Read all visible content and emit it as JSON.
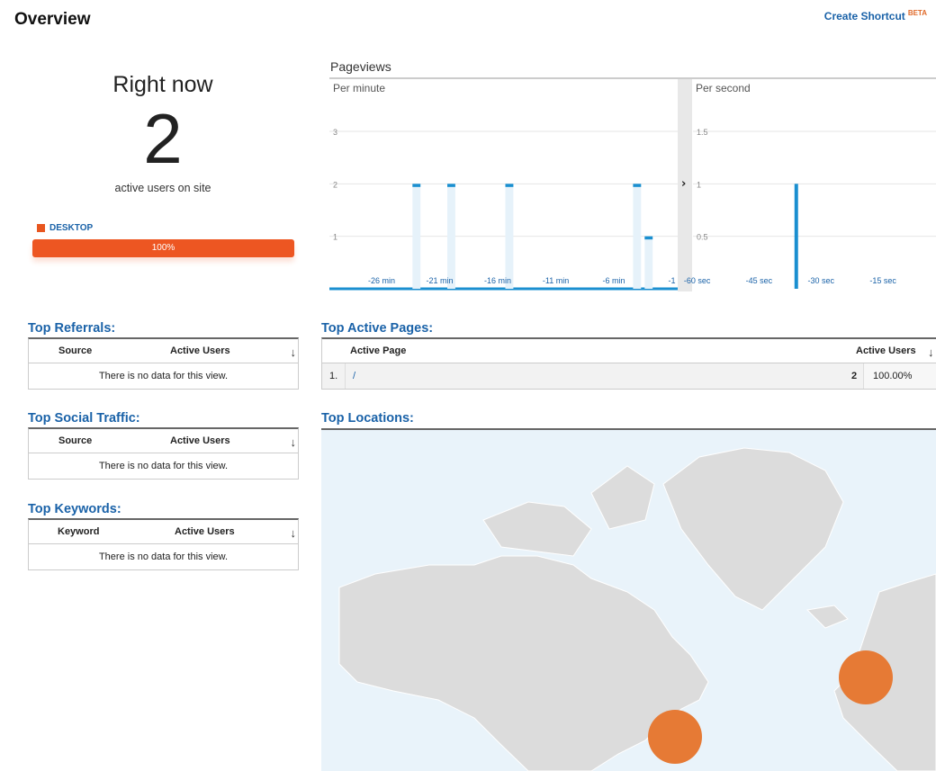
{
  "header": {
    "title": "Overview",
    "shortcut_label": "Create Shortcut",
    "shortcut_badge": "BETA"
  },
  "right_now": {
    "title": "Right now",
    "count": "2",
    "subtitle": "active users on site",
    "device_label": "DESKTOP",
    "device_percent": "100%",
    "device_fraction": 1.0,
    "device_color": "#ed5622"
  },
  "pageviews": {
    "title": "Pageviews",
    "per_minute_label": "Per minute",
    "per_second_label": "Per second",
    "expand_glyph": "›"
  },
  "chart_data": [
    {
      "type": "bar",
      "title": "Per minute",
      "x": [
        -30,
        -29,
        -28,
        -27,
        -26,
        -25,
        -24,
        -23,
        -22,
        -21,
        -20,
        -19,
        -18,
        -17,
        -16,
        -15,
        -14,
        -13,
        -12,
        -11,
        -10,
        -9,
        -8,
        -7,
        -6,
        -5,
        -4,
        -3,
        -2,
        -1
      ],
      "values": [
        0,
        0,
        0,
        0,
        0,
        0,
        0,
        2,
        0,
        0,
        2,
        0,
        0,
        0,
        0,
        2,
        0,
        0,
        0,
        0,
        0,
        0,
        0,
        0,
        0,
        0,
        2,
        1,
        0,
        0
      ],
      "tick_labels": [
        "-26 min",
        "-21 min",
        "-16 min",
        "-11 min",
        "-6 min",
        "-1"
      ],
      "tick_values": [
        -26,
        -21,
        -16,
        -11,
        -6,
        -1
      ],
      "ytick_labels": [
        "1",
        "2",
        "3"
      ],
      "ylim": [
        0,
        3
      ],
      "color": "#1a8fd0"
    },
    {
      "type": "bar",
      "title": "Per second",
      "x": [
        -36
      ],
      "values": [
        1
      ],
      "tick_labels": [
        "-60 sec",
        "-45 sec",
        "-30 sec",
        "-15 sec"
      ],
      "tick_values": [
        -60,
        -45,
        -30,
        -15
      ],
      "ytick_labels": [
        "0.5",
        "1",
        "1.5"
      ],
      "ylim": [
        0,
        1.5
      ],
      "color": "#1a8fd0"
    }
  ],
  "referrals": {
    "title": "Top Referrals:",
    "col1": "Source",
    "col2": "Active Users",
    "empty": "There is no data for this view."
  },
  "social": {
    "title": "Top Social Traffic:",
    "col1": "Source",
    "col2": "Active Users",
    "empty": "There is no data for this view."
  },
  "keywords": {
    "title": "Top Keywords:",
    "col1": "Keyword",
    "col2": "Active Users",
    "empty": "There is no data for this view."
  },
  "active_pages": {
    "title": "Top Active Pages:",
    "col1": "Active Page",
    "col2": "Active Users",
    "rows": [
      {
        "rank": "1.",
        "page": "/",
        "users": "2",
        "percent": "100.00%"
      }
    ]
  },
  "locations": {
    "title": "Top Locations:",
    "marker_color": "#e67a35"
  }
}
